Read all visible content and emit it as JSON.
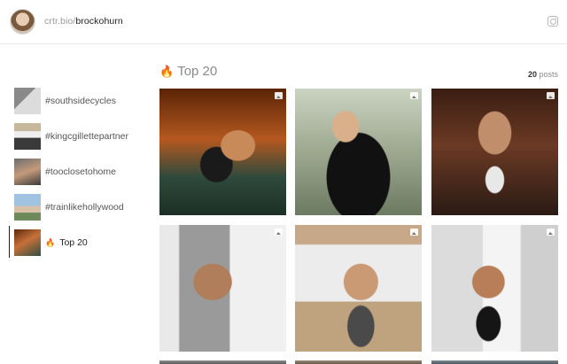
{
  "header": {
    "brand_prefix": "crtr.bio/",
    "username": "brockohurn",
    "avatar_icon": "profile-avatar",
    "social_icon": "instagram-icon"
  },
  "sidebar": {
    "items": [
      {
        "label": "#southsidecycles",
        "active": false
      },
      {
        "label": "#kingcgillettepartner",
        "active": false
      },
      {
        "label": "#tooclosetohome",
        "active": false
      },
      {
        "label": "#trainlikehollywood",
        "active": false
      },
      {
        "label": "Top 20",
        "active": true,
        "icon": "fire-icon"
      }
    ]
  },
  "main": {
    "title": "Top 20",
    "title_icon": "fire-icon",
    "post_count": "20",
    "post_count_label": "posts",
    "photos": [
      {
        "badge_icon": "image-icon"
      },
      {
        "badge_icon": "image-icon"
      },
      {
        "badge_icon": "image-icon"
      },
      {
        "badge_icon": "image-icon"
      },
      {
        "badge_icon": "image-icon"
      },
      {
        "badge_icon": "image-icon"
      },
      {},
      {},
      {}
    ]
  },
  "colors": {
    "accent_fire": "#ff7a1a",
    "text_muted": "#8a8a8a",
    "text_dark": "#222222"
  }
}
